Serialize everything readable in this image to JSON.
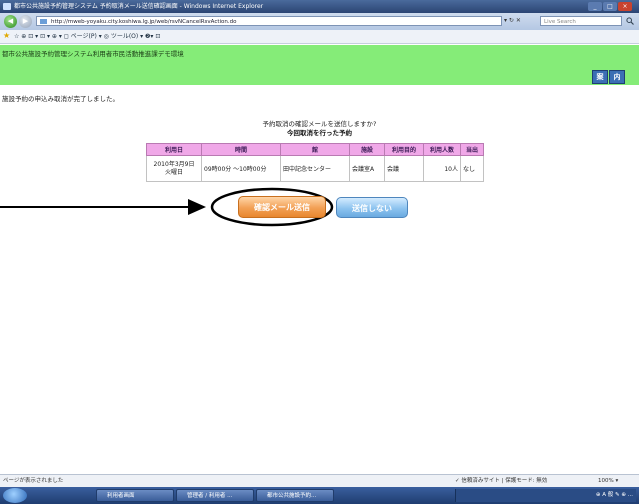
{
  "window": {
    "title": "都市公共施設予約管理システム  予約取消メール送信確認画面 - Windows Internet Explorer",
    "controls": [
      "_",
      "□",
      "×"
    ]
  },
  "address_bar": {
    "url": "http://mweb-yoyaku.city.koshiwa.lg.jp/web/rsvNCancelRsvAction.do",
    "search_placeholder": "Live Search"
  },
  "command_bar": {
    "items": "☆ ⊕  ⊡ ▾ ⊡ ▾ ⊕ ▾ ◻ ページ(P) ▾ ◎ ツール(O) ▾ ❷▾ ⊡"
  },
  "header": {
    "title": "都市公共施設予約管理システム利用者市民活動推進課デモ環境",
    "buttons": [
      "案",
      "内"
    ]
  },
  "main": {
    "completion_message": "施設予約の申込み取消が完了しました。",
    "confirm_question": "予約取消の確認メールを送信しますか?",
    "cancelled_label": "今回取消を行った予約",
    "table": {
      "headers": [
        "利用日",
        "時間",
        "館",
        "施設",
        "利用目的",
        "利用人数",
        "当出"
      ],
      "rows": [
        [
          "2010年3月9日\n火曜日",
          "09時00分 〜10時00分",
          "田中記念センター",
          "会議室A",
          "会議",
          "10人",
          "なし"
        ]
      ]
    },
    "send_button": "確認メール送信",
    "no_send_button": "送信しない"
  },
  "status_bar": {
    "left": "ページが表示されました",
    "zone": "✓ 信頼済みサイト | 保護モード: 無効",
    "zoom": "100% ▾"
  },
  "taskbar": {
    "tasks": [
      "利用者画面",
      "管理者 / 利用者 ...",
      "都市公共施設予約..."
    ],
    "tray": "⊕ A 般 ✎ ⊕ ..."
  }
}
